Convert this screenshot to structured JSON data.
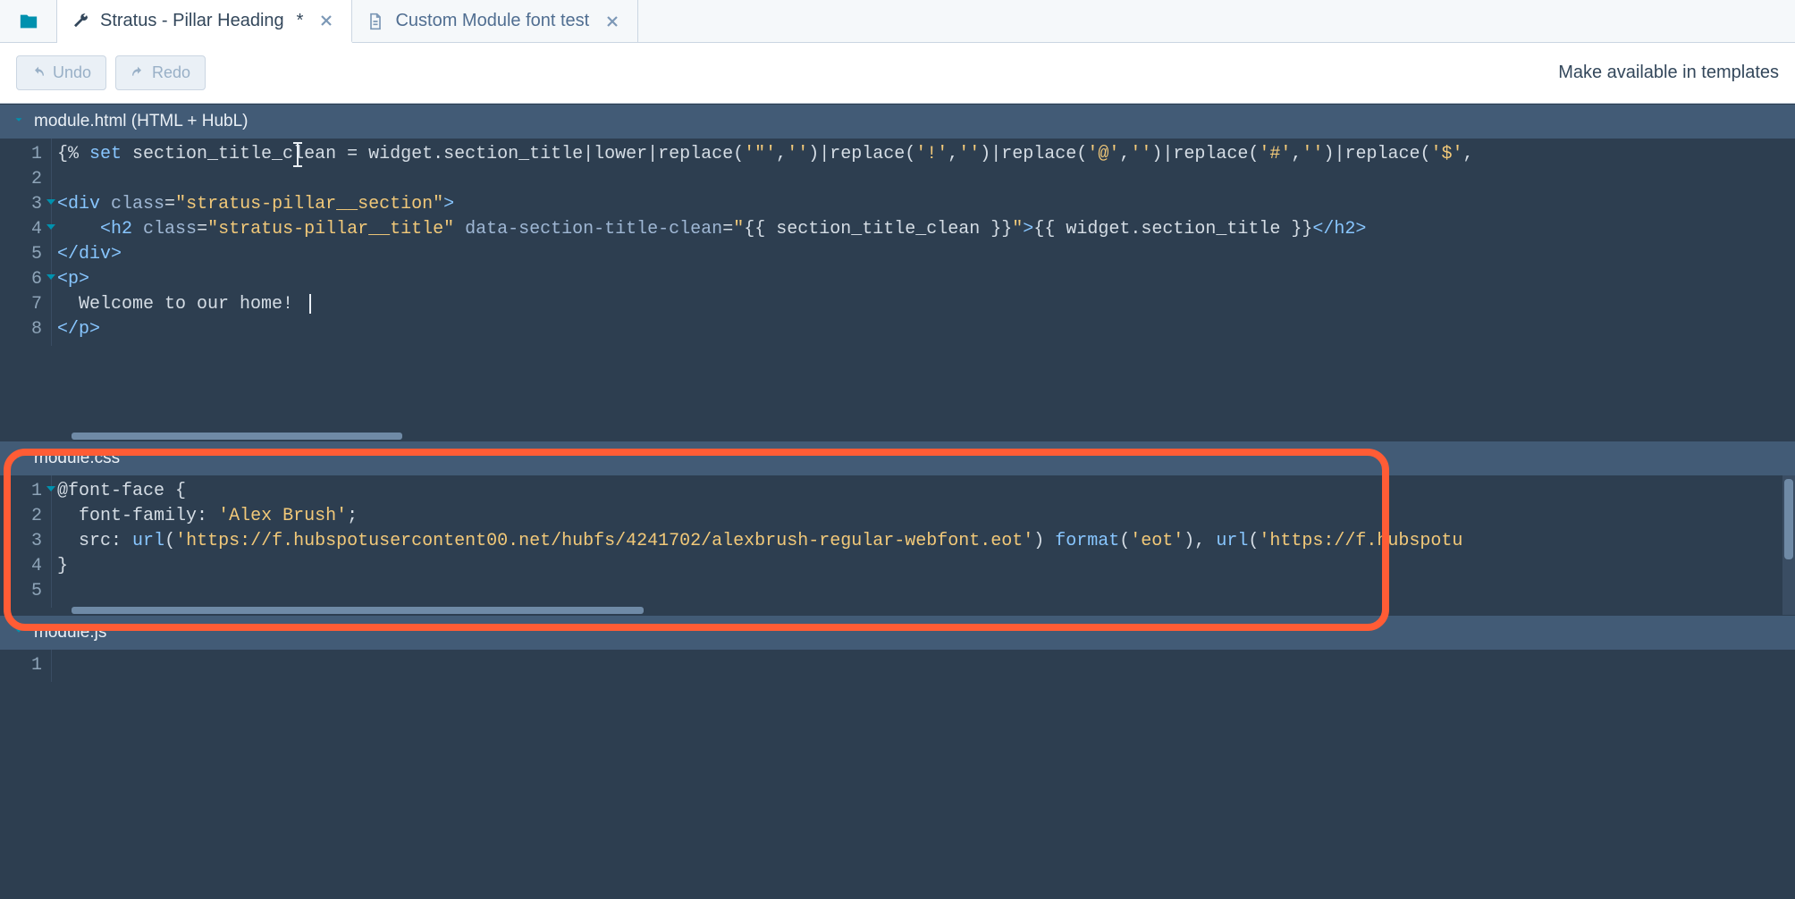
{
  "tabs": [
    {
      "label": "Stratus - Pillar Heading",
      "dirty": "*",
      "icon": "wrench"
    },
    {
      "label": "Custom Module font test",
      "dirty": "",
      "icon": "file"
    }
  ],
  "toolbar": {
    "undo_label": "Undo",
    "redo_label": "Redo",
    "right_label": "Make available in templates"
  },
  "panels": {
    "html": {
      "title": "module.html (HTML + HubL)",
      "lines": [
        "{% set section_title_clean = widget.section_title|lower|replace('\"','')|replace('!','')|replace('@','')|replace('#','')|replace('$',",
        "",
        "<div class=\"stratus-pillar__section\">",
        "    <h2 class=\"stratus-pillar__title\" data-section-title-clean=\"{{ section_title_clean }}\">{{ widget.section_title }}</h2>",
        "</div>",
        "<p>",
        "  Welcome to our home! ",
        "</p>"
      ]
    },
    "css": {
      "title": "module.css",
      "lines": [
        "@font-face {",
        "  font-family: 'Alex Brush';",
        "  src: url('https://f.hubspotusercontent00.net/hubfs/4241702/alexbrush-regular-webfont.eot') format('eot'), url('https://f.hubspotu",
        "}",
        ""
      ]
    },
    "js": {
      "title": "module.js",
      "lines": [
        ""
      ]
    }
  }
}
